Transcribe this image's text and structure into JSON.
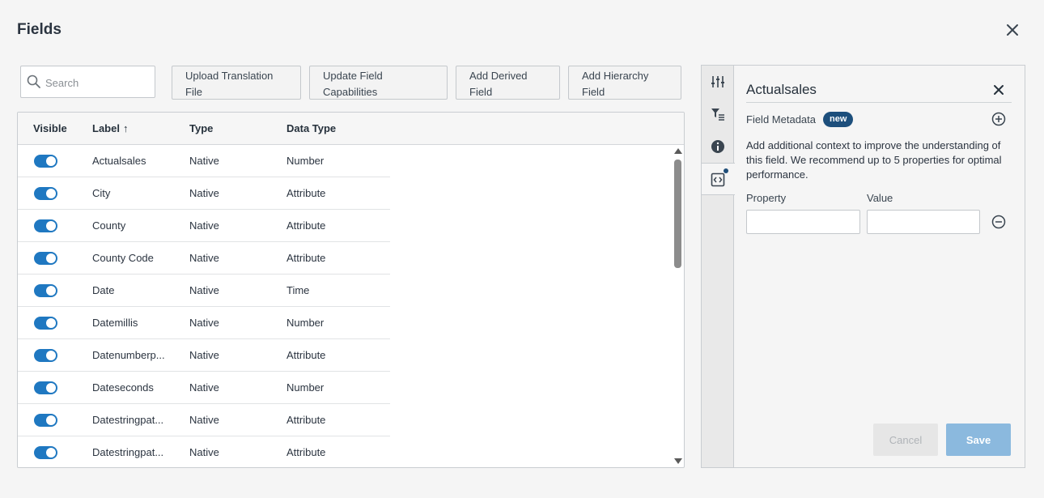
{
  "dialog": {
    "title": "Fields"
  },
  "toolbar": {
    "search_placeholder": "Search",
    "upload_translation_label": "Upload Translation File",
    "update_capabilities_label": "Update Field Capabilities",
    "add_derived_label": "Add Derived Field",
    "add_hierarchy_label": "Add Hierarchy Field"
  },
  "table": {
    "columns": {
      "visible": "Visible",
      "label": "Label",
      "label_sort": "↑",
      "type": "Type",
      "data_type": "Data Type"
    },
    "rows": [
      {
        "visible": true,
        "label": "Actualsales",
        "type": "Native",
        "data_type": "Number"
      },
      {
        "visible": true,
        "label": "City",
        "type": "Native",
        "data_type": "Attribute"
      },
      {
        "visible": true,
        "label": "County",
        "type": "Native",
        "data_type": "Attribute"
      },
      {
        "visible": true,
        "label": "County Code",
        "type": "Native",
        "data_type": "Attribute"
      },
      {
        "visible": true,
        "label": "Date",
        "type": "Native",
        "data_type": "Time"
      },
      {
        "visible": true,
        "label": "Datemillis",
        "type": "Native",
        "data_type": "Number"
      },
      {
        "visible": true,
        "label": "Datenumberp...",
        "type": "Native",
        "data_type": "Attribute"
      },
      {
        "visible": true,
        "label": "Dateseconds",
        "type": "Native",
        "data_type": "Number"
      },
      {
        "visible": true,
        "label": "Datestringpat...",
        "type": "Native",
        "data_type": "Attribute"
      },
      {
        "visible": true,
        "label": "Datestringpat...",
        "type": "Native",
        "data_type": "Attribute"
      }
    ]
  },
  "side_panel": {
    "title": "Actualsales",
    "metadata_label": "Field Metadata",
    "badge": "new",
    "description": "Add additional context to improve the understanding of this field. We recommend up to 5 properties for optimal performance.",
    "property_label": "Property",
    "value_label": "Value",
    "property_value": "",
    "value_value": "",
    "cancel_label": "Cancel",
    "save_label": "Save",
    "tabs": [
      "sliders-icon",
      "filter-list-icon",
      "info-icon",
      "code-icon"
    ],
    "active_tab": "code-icon"
  },
  "colors": {
    "accent": "#1f78c1",
    "badge": "#1d4f7c",
    "save_disabled": "#8bb9de"
  }
}
